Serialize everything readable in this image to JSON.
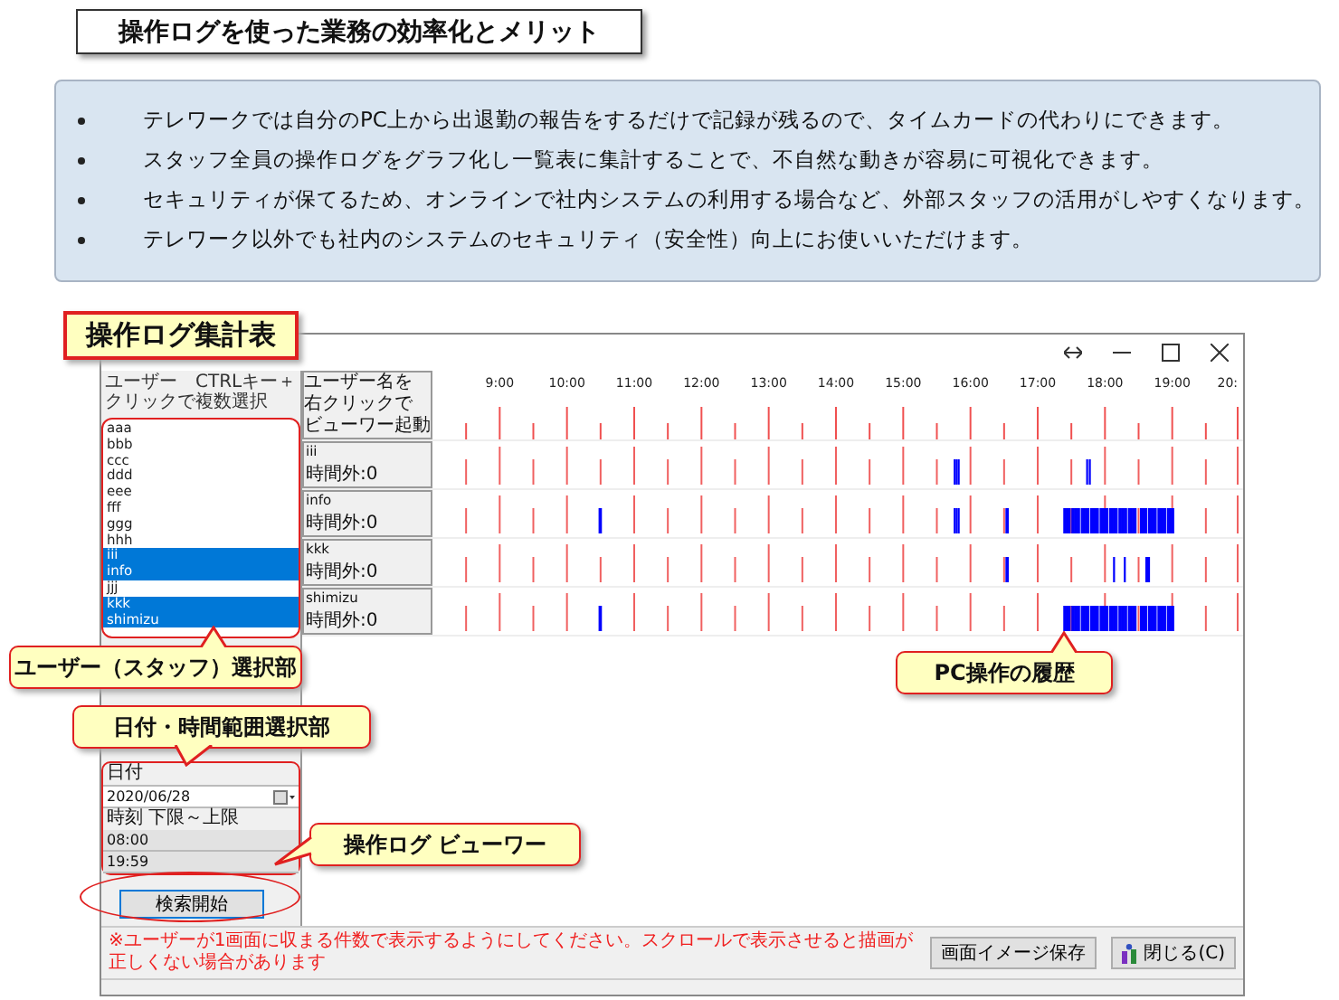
{
  "heading": "操作ログを使った業務の効率化とメリット",
  "benefits": [
    "テレワークでは自分のPC上から出退勤の報告をするだけで記録が残るので、タイムカードの代わりにできます。",
    "スタッフ全員の操作ログをグラフ化し一覧表に集計することで、不自然な動きが容易に可視化できます。",
    "セキュリティが保てるため、オンラインで社内システムの利用する場合など、外部スタッフの活用がしやすくなります。",
    "テレワーク以外でも社内のシステムのセキュリティ（安全性）向上にお使いいただけます。"
  ],
  "app_window": {
    "user_panel": {
      "header": "ユーザー　CTRLキー＋クリックで複数選択",
      "users": [
        {
          "name": "aaa",
          "selected": false
        },
        {
          "name": "bbb",
          "selected": false
        },
        {
          "name": "ccc",
          "selected": false
        },
        {
          "name": "ddd",
          "selected": false
        },
        {
          "name": "eee",
          "selected": false
        },
        {
          "name": "fff",
          "selected": false
        },
        {
          "name": "ggg",
          "selected": false
        },
        {
          "name": "hhh",
          "selected": false
        },
        {
          "name": "iii",
          "selected": true
        },
        {
          "name": "info",
          "selected": true
        },
        {
          "name": "jjj",
          "selected": false
        },
        {
          "name": "kkk",
          "selected": true
        },
        {
          "name": "shimizu",
          "selected": true
        }
      ]
    },
    "date_label": "日付",
    "date_value": "2020/06/28",
    "time_label": "時刻 下限～上限",
    "time_from": "08:00",
    "time_to": "19:59",
    "search_button": "検索開始",
    "timeline": {
      "header_label": [
        "ユーザー名を",
        "右クリックで",
        "ビューワー起動"
      ],
      "hours": [
        "9:00",
        "10:00",
        "11:00",
        "12:00",
        "13:00",
        "14:00",
        "15:00",
        "16:00",
        "17:00",
        "18:00",
        "19:00",
        "20:"
      ],
      "rows": [
        {
          "user": "iii",
          "note": "時間外:0"
        },
        {
          "user": "info",
          "note": "時間外:0"
        },
        {
          "user": "kkk",
          "note": "時間外:0"
        },
        {
          "user": "shimizu",
          "note": "時間外:0"
        }
      ]
    },
    "notice": "※ユーザーが1画面に収まる件数で表示するようにしてください。スクロールで表示させると描画が正しくない場合があります",
    "buttons": [
      "画面イメージ保存",
      "閉じる(C)"
    ]
  },
  "callouts": [
    "操作ログ集計表",
    "ユーザー（スタッフ）選択部",
    "日付・時間範囲選択部",
    "操作ログ ビューワー",
    "PC操作の履歴"
  ]
}
